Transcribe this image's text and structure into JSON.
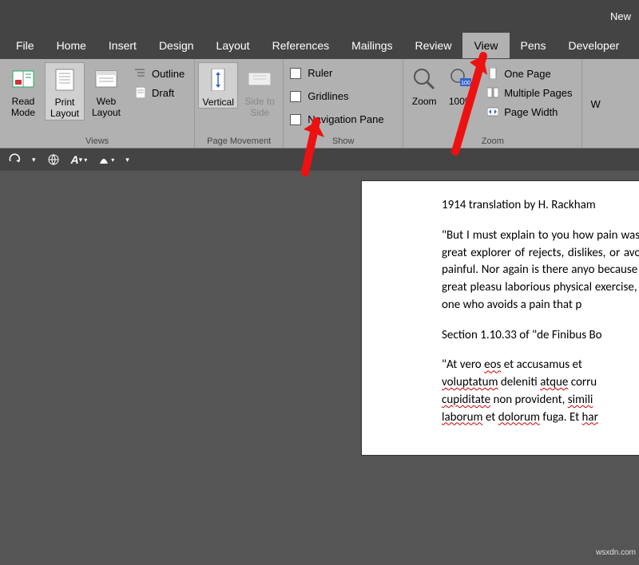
{
  "title_bar": {
    "right_text": "New"
  },
  "tabs": {
    "file": "File",
    "home": "Home",
    "insert": "Insert",
    "design": "Design",
    "layout": "Layout",
    "references": "References",
    "mailings": "Mailings",
    "review": "Review",
    "view": "View",
    "pens": "Pens",
    "developer": "Developer"
  },
  "ribbon": {
    "views": {
      "label": "Views",
      "read_mode": "Read Mode",
      "print_layout": "Print Layout",
      "web_layout": "Web Layout",
      "outline": "Outline",
      "draft": "Draft"
    },
    "page_movement": {
      "label": "Page Movement",
      "vertical": "Vertical",
      "side_to_side": "Side to Side"
    },
    "show": {
      "label": "Show",
      "ruler": "Ruler",
      "gridlines": "Gridlines",
      "nav_pane": "Navigation Pane"
    },
    "zoom": {
      "label": "Zoom",
      "zoom": "Zoom",
      "p100": "100%",
      "one_page": "One Page",
      "multiple_pages": "Multiple Pages",
      "page_width": "Page Width"
    },
    "window_partial": "W"
  },
  "doc": {
    "heading": "1914 translation by H. Rackham",
    "para1": "\"But I must explain to you how pain was born and I will give you teachings of the great explorer of rejects, dislikes, or avoids pleas not know how to pursue pleas painful. Nor again is there anyo because it is pain, but because procure him some great pleasu laborious physical exercise, exce to find fault with a man who cho or one who avoids a pain that p",
    "section": "Section 1.10.33 of \"de Finibus Bo",
    "at_vero": "\"At vero ",
    "eos": "eos",
    "et_acc": " et accusamus et ",
    "voluptatum": "voluptatum",
    "deleniti": " deleniti ",
    "atque": "atque",
    "corru": " corru",
    "cupiditate": "cupiditate",
    "non_prov": " non provident, ",
    "simili": "simili",
    "laborum": "laborum",
    "et_dol": " et ",
    "dolorum": "dolorum",
    "fuga": " fuga. Et ",
    "har": "har"
  },
  "watermark": "wsxdn.com"
}
